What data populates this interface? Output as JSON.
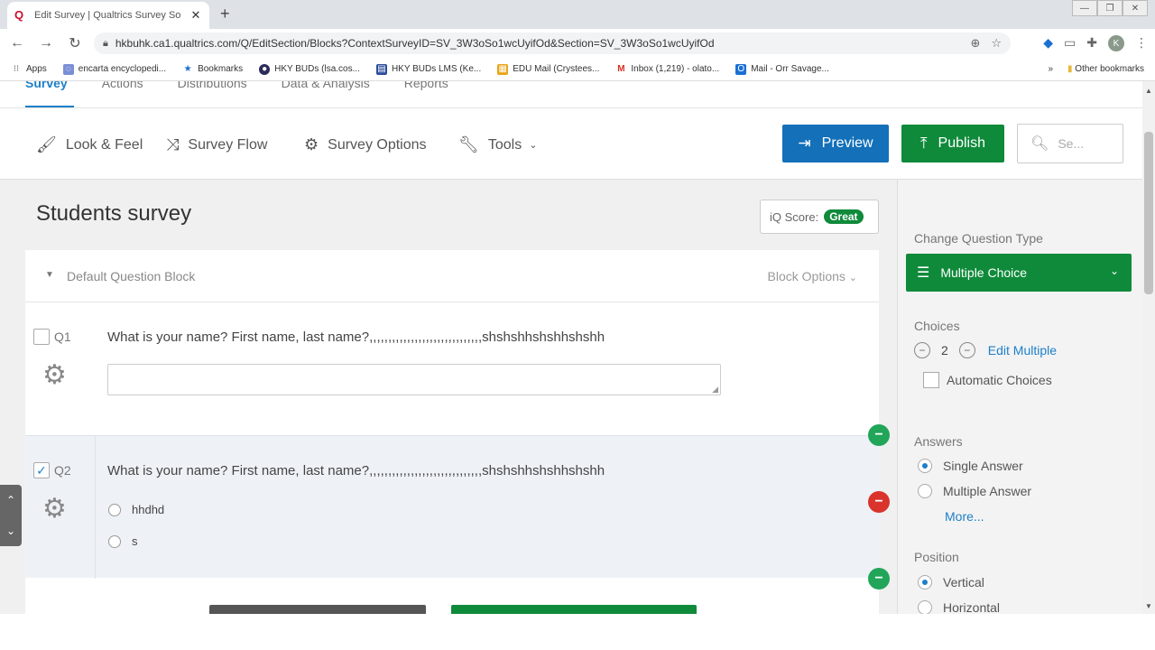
{
  "browser": {
    "tab_title": "Edit Survey | Qualtrics Survey So",
    "url": "hkbuhk.ca1.qualtrics.com/Q/EditSection/Blocks?ContextSurveyID=SV_3W3oSo1wcUyifOd&Section=SV_3W3oSo1wcUyifOd",
    "bookmarks": [
      "Apps",
      "encarta encyclopedi...",
      "Bookmarks",
      "HKY BUDs (lsa.cos...",
      "HKY BUDs LMS (Ke...",
      "EDU Mail (Crystees...",
      "Inbox (1,219) - olato...",
      "Mail - Orr Savage..."
    ],
    "other_bookmarks": "Other bookmarks",
    "avatar_letter": "K"
  },
  "qnav": {
    "tabs": [
      "Survey",
      "Actions",
      "Distributions",
      "Data & Analysis",
      "Reports"
    ]
  },
  "toolbar": {
    "look_feel": "Look & Feel",
    "survey_flow": "Survey Flow",
    "survey_options": "Survey Options",
    "tools": "Tools",
    "preview": "Preview",
    "publish": "Publish",
    "search_placeholder": "Se..."
  },
  "survey": {
    "title": "Students survey",
    "iq_label": "iQ Score:",
    "iq_value": "Great",
    "block_name": "Default Question Block",
    "block_options": "Block Options",
    "questions": [
      {
        "id": "Q1",
        "text": "What is your name? First name, last name?,,,,,,,,,,,,,,,,,,,,,,,,,,,,,,shshshhshshhshshh",
        "checked": false
      },
      {
        "id": "Q2",
        "text": "What is your name? First name, last name?,,,,,,,,,,,,,,,,,,,,,,,,,,,,,,shshshhshshhshshh",
        "checked": true,
        "choices": [
          "hhdhd",
          "s"
        ]
      }
    ]
  },
  "panel": {
    "change_type_label": "Change Question Type",
    "question_type": "Multiple Choice",
    "choices_label": "Choices",
    "choices_count": "2",
    "edit_multiple": "Edit Multiple",
    "automatic_choices": "Automatic Choices",
    "answers_label": "Answers",
    "single_answer": "Single Answer",
    "multiple_answer": "Multiple Answer",
    "more": "More...",
    "position_label": "Position",
    "vertical": "Vertical",
    "horizontal": "Horizontal"
  },
  "colors": {
    "blue": "#1370b9",
    "green": "#0f8a3a",
    "red": "#d9332b"
  }
}
